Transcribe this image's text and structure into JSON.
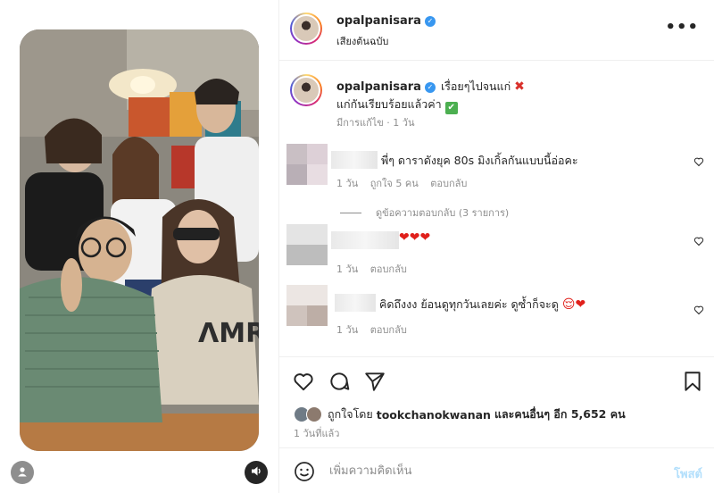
{
  "header": {
    "username": "opalpanisara",
    "audio_label": "เสียงต้นฉบับ",
    "more_label": "•••"
  },
  "caption": {
    "username": "opalpanisara",
    "line1": "เรื่อยๆไปจนแก่",
    "line2": "แก่กันเรียบร้อยแล้วค่า",
    "meta": "มีการแก้ไข · 1 วัน",
    "x_mark": "✖",
    "check_mark": "✔"
  },
  "comments": [
    {
      "text": "พี่ๆ ดาราดังยุค 80s มิงเกิ้ลกันแบบนี้อ่อคะ",
      "time": "1 วัน",
      "likes": "ถูกใจ 5 คน",
      "reply_label": "ตอบกลับ",
      "view_replies": "ดูข้อความตอบกลับ (3 รายการ)"
    },
    {
      "text": "❤❤❤",
      "time": "1 วัน",
      "reply_label": "ตอบกลับ"
    },
    {
      "text": "คิดถึงงง ย้อนดูทุกวันเลยค่ะ ดูซ้ำก็จะดู",
      "emoji": "😌❤",
      "time": "1 วัน",
      "reply_label": "ตอบกลับ"
    }
  ],
  "likes": {
    "prefix": "ถูกใจโดย",
    "user": "tookchanokwanan",
    "suffix": "และคนอื่นๆ อีก 5,652 คน"
  },
  "time_ago": "1 วันที่แล้ว",
  "comment_input": {
    "placeholder": "เพิ่มความคิดเห็น",
    "post_label": "โพสต์"
  },
  "colors": {
    "verified": "#3897f0",
    "link_blue_disabled": "#b2dffc",
    "heart_red": "#e0201b"
  },
  "icons": [
    "heart-icon",
    "comment-icon",
    "share-icon",
    "bookmark-icon",
    "emoji-icon",
    "audio-icon",
    "user-icon"
  ]
}
